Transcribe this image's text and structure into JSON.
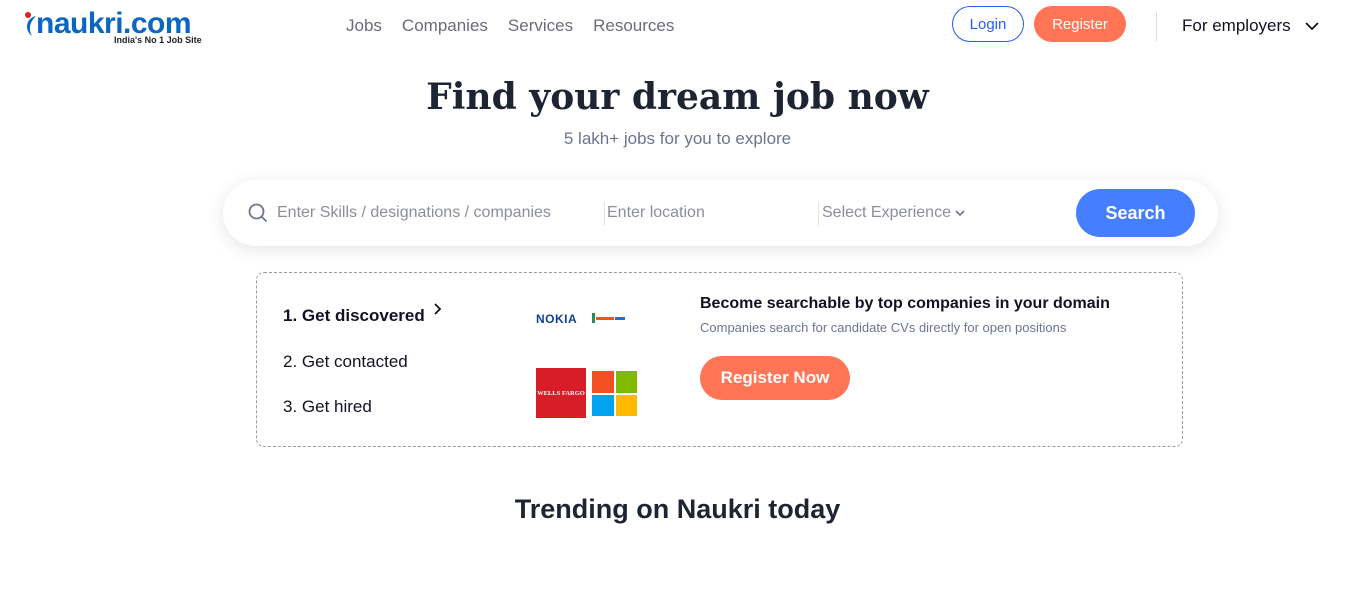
{
  "header": {
    "logo_text": "naukri.com",
    "logo_tagline": "India's No 1 Job Site",
    "nav": [
      "Jobs",
      "Companies",
      "Services",
      "Resources"
    ],
    "login_label": "Login",
    "register_label": "Register",
    "employers_label": "For employers"
  },
  "hero": {
    "title": "Find your dream job now",
    "subtitle": "5 lakh+ jobs for you to explore"
  },
  "search": {
    "skills_placeholder": "Enter Skills / designations / companies",
    "location_placeholder": "Enter location",
    "experience_placeholder": "Select Experience",
    "button_label": "Search"
  },
  "promo": {
    "steps": [
      "1. Get discovered",
      "2. Get contacted",
      "3. Get hired"
    ],
    "logos": {
      "nokia": "NOKIA",
      "wells_fargo": "WELLS FARGO"
    },
    "title": "Become searchable by top companies in your domain",
    "subtitle": "Companies search for candidate CVs directly for open positions",
    "cta_label": "Register Now"
  },
  "trending": {
    "title": "Trending on Naukri today"
  },
  "colors": {
    "brand_blue": "#0a66c2",
    "accent_orange": "#ff7555",
    "search_blue": "#457eff",
    "login_blue": "#275df5"
  }
}
